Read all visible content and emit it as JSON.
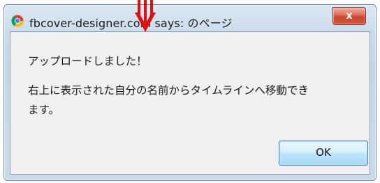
{
  "dialog": {
    "title": "fbcover-designer.com says: のページ",
    "message_lines": [
      "アップロードしました！",
      "右上に表示された自分の名前からタイムラインへ移動でき",
      "ます。"
    ],
    "ok_label": "OK",
    "close_label": "x"
  },
  "colors": {
    "annotation_arrow": "#e01010",
    "close_button": "#c8432a",
    "frame": "#c3d5e6"
  }
}
